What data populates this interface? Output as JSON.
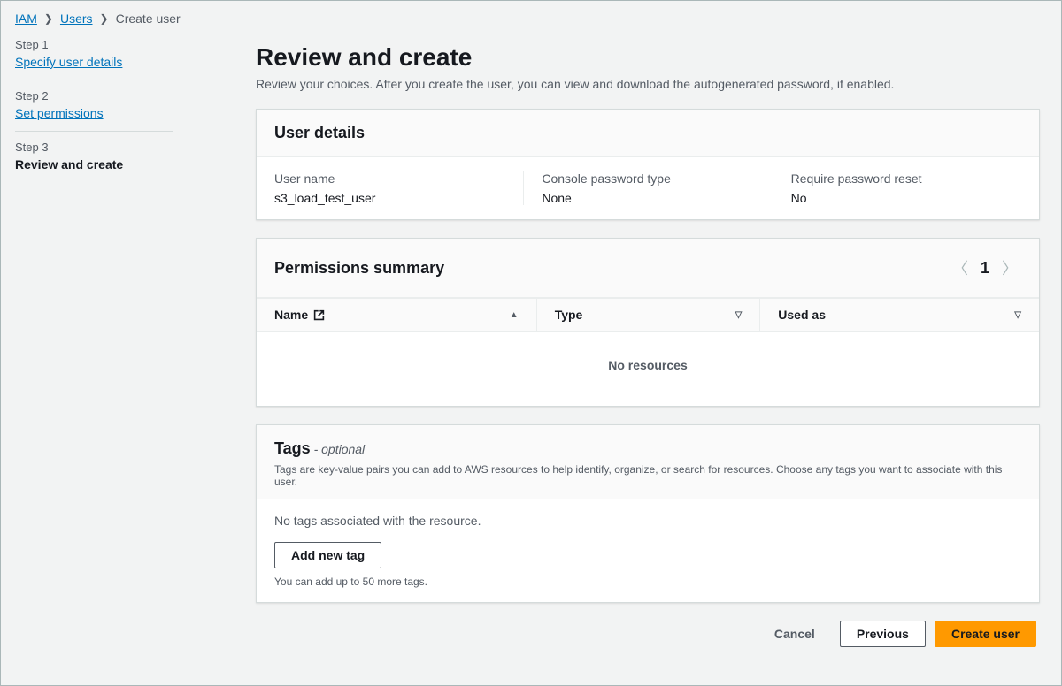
{
  "breadcrumb": {
    "iam": "IAM",
    "users": "Users",
    "current": "Create user"
  },
  "steps": {
    "s1_eyebrow": "Step 1",
    "s1_label": "Specify user details",
    "s2_eyebrow": "Step 2",
    "s2_label": "Set permissions",
    "s3_eyebrow": "Step 3",
    "s3_label": "Review and create"
  },
  "page": {
    "title": "Review and create",
    "subtitle": "Review your choices. After you create the user, you can view and download the autogenerated password, if enabled."
  },
  "user_details": {
    "heading": "User details",
    "username_label": "User name",
    "username_value": "s3_load_test_user",
    "pwtype_label": "Console password type",
    "pwtype_value": "None",
    "reset_label": "Require password reset",
    "reset_value": "No"
  },
  "permissions": {
    "heading": "Permissions summary",
    "page_number": "1",
    "col_name": "Name",
    "col_type": "Type",
    "col_used": "Used as",
    "empty": "No resources"
  },
  "tags": {
    "heading": "Tags",
    "optional": " - optional",
    "desc": "Tags are key-value pairs you can add to AWS resources to help identify, organize, or search for resources. Choose any tags you want to associate with this user.",
    "none": "No tags associated with the resource.",
    "add_btn": "Add new tag",
    "hint": "You can add up to 50 more tags."
  },
  "actions": {
    "cancel": "Cancel",
    "previous": "Previous",
    "create": "Create user"
  }
}
